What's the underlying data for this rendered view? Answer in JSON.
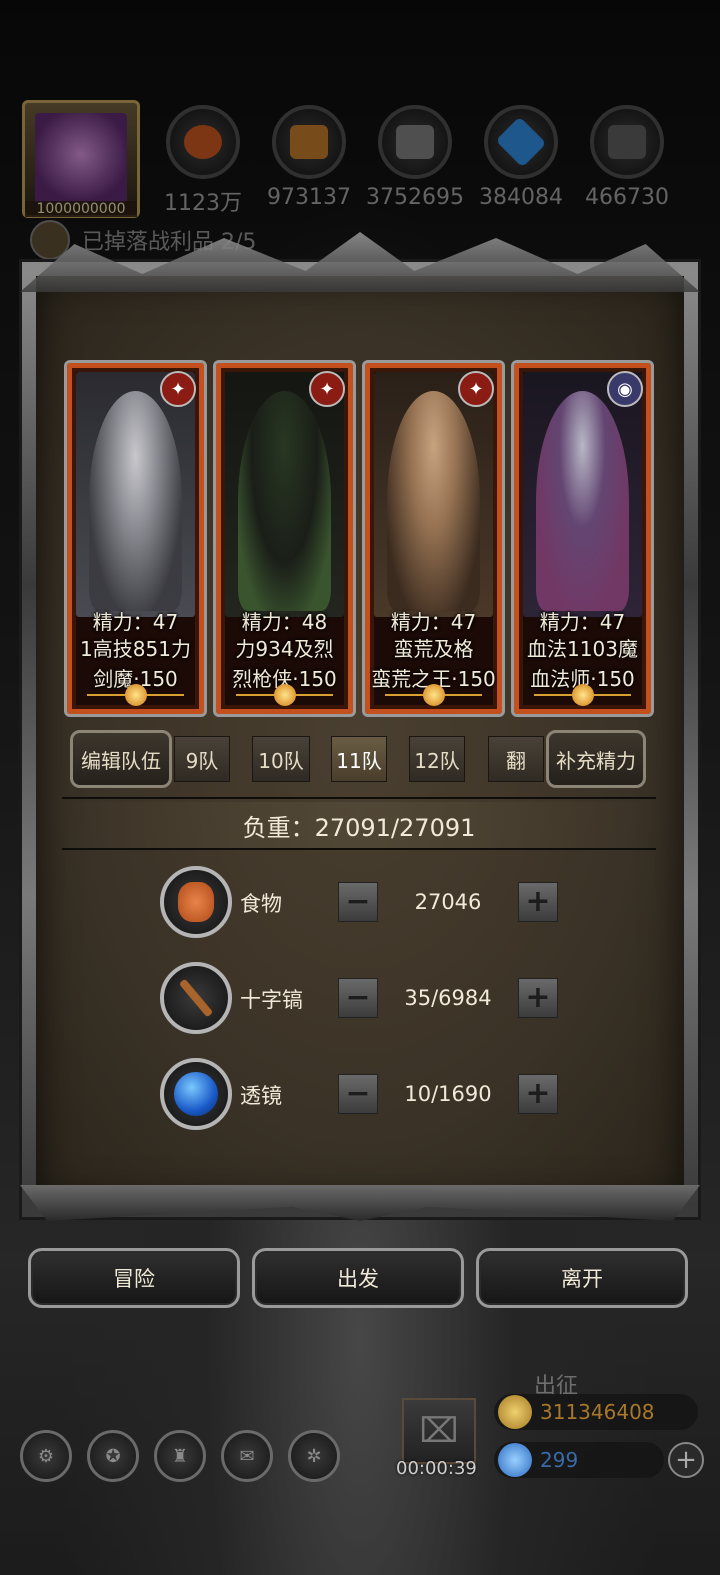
{
  "top_bar": {
    "avatar_value": "1000000000",
    "resources": [
      {
        "icon": "food-icon",
        "value": "1123万",
        "color": "#c0541f"
      },
      {
        "icon": "wood-icon",
        "value": "973137",
        "color": "#b8742a"
      },
      {
        "icon": "stone-icon",
        "value": "3752695",
        "color": "#7a7a7a"
      },
      {
        "icon": "crystal-icon",
        "value": "384084",
        "color": "#2e86d6"
      },
      {
        "icon": "iron-icon",
        "value": "466730",
        "color": "#5a5a5a"
      }
    ],
    "loot_text": "已掉落战利品 2/5"
  },
  "heroes": [
    {
      "stamina": "精力：47",
      "stats": "1高技851力",
      "class": "剑魔·150",
      "faction_color": "#8a1c14",
      "palette": [
        "#3a3a40",
        "#b8b8c0"
      ]
    },
    {
      "stamina": "精力：48",
      "stats": "力934及烈",
      "class": "烈枪侠·150",
      "faction_color": "#8a1c14",
      "palette": [
        "#1a1e18",
        "#3c5a30"
      ]
    },
    {
      "stamina": "精力：47",
      "stats": "蛮荒及格",
      "class": "蛮荒之王·150",
      "faction_color": "#8a1c14",
      "palette": [
        "#3a2a1e",
        "#c8a07a"
      ]
    },
    {
      "stamina": "精力：47",
      "stats": "血法1103魔",
      "class": "血法师·150",
      "faction_color": "#3a3a6a",
      "palette": [
        "#241a2e",
        "#7a3a6a"
      ]
    }
  ],
  "tabs": {
    "edit_team": "编辑队伍",
    "teams": [
      "9队",
      "10队",
      "11队",
      "12队"
    ],
    "active_team": "11队",
    "flip": "翻",
    "refill": "补充精力"
  },
  "load": {
    "label": "负重：27091/27091"
  },
  "supplies": [
    {
      "icon": "meat-icon",
      "name": "食物",
      "value": "27046"
    },
    {
      "icon": "pickaxe-icon",
      "name": "十字镐",
      "value": "35/6984"
    },
    {
      "icon": "lens-icon",
      "name": "透镜",
      "value": "10/1690"
    }
  ],
  "actions": {
    "adventure": "冒险",
    "depart": "出发",
    "leave": "离开"
  },
  "hud": {
    "expedition_label": "出征",
    "timer": "00:00:39",
    "gold": "311346408",
    "gems": "299",
    "gold_color": "#c8a040",
    "gem_color": "#3a8ad6"
  }
}
